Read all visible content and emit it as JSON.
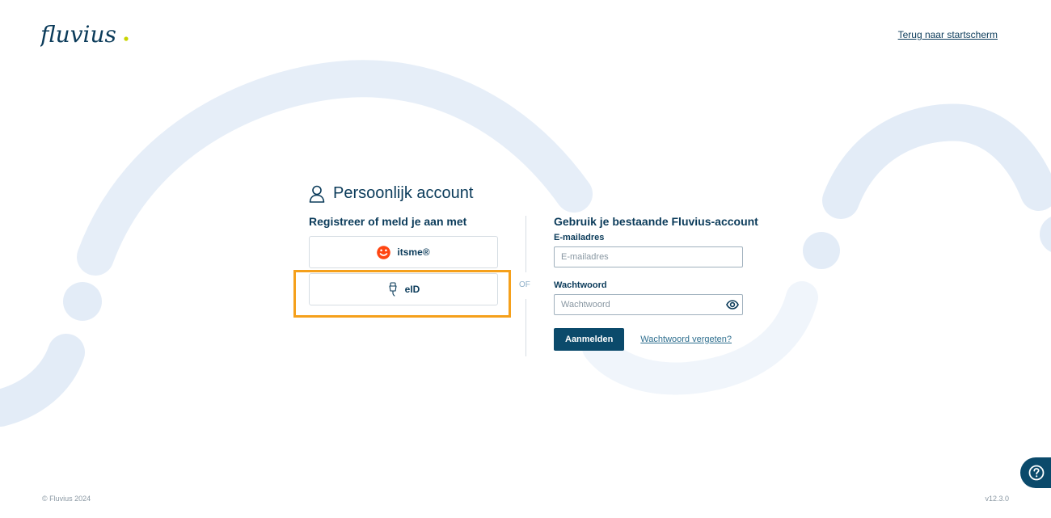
{
  "header": {
    "logo_text": "fluvius",
    "back_link": "Terug naar startscherm"
  },
  "account": {
    "title": "Persoonlijk account",
    "icon": "user-icon"
  },
  "register": {
    "title": "Registreer of meld je aan met",
    "options": [
      {
        "label": "itsme®",
        "icon": "itsme-icon"
      },
      {
        "label": "eID",
        "icon": "eid-card-reader-icon"
      }
    ]
  },
  "separator": {
    "label": "OF"
  },
  "login": {
    "title": "Gebruik je bestaande Fluvius-account",
    "email_label": "E-mailadres",
    "email_placeholder": "E-mailadres",
    "email_value": "",
    "password_label": "Wachtwoord",
    "password_placeholder": "Wachtwoord",
    "password_value": "",
    "submit_label": "Aanmelden",
    "forgot_label": "Wachtwoord vergeten?"
  },
  "footer": {
    "copyright": "© Fluvius 2024",
    "version": "v12.3.0"
  },
  "help": {
    "icon": "question-icon"
  },
  "colors": {
    "primary": "#0b4a6b",
    "text": "#0b3b5a",
    "highlight": "#f5a01b",
    "itsme": "#ff4612",
    "logo_dot": "#c8d400",
    "decoration": "#e3ecf7"
  }
}
